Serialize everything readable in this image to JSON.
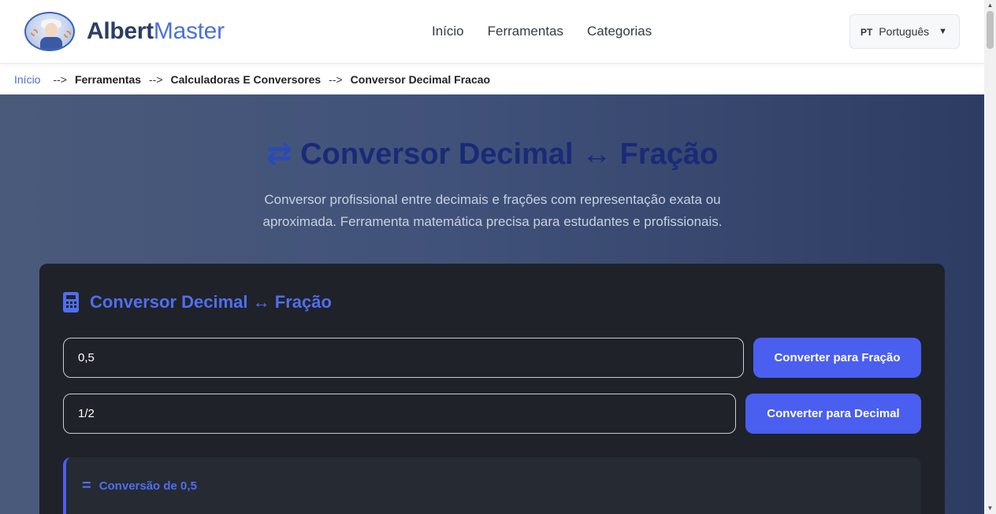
{
  "brand": {
    "part1": "Albert",
    "part2": "Master"
  },
  "nav": [
    {
      "label": "Início"
    },
    {
      "label": "Ferramentas"
    },
    {
      "label": "Categorias"
    }
  ],
  "language": {
    "code": "PT",
    "name": "Português",
    "caret": "▼"
  },
  "breadcrumb": {
    "separator": "-->",
    "items": [
      "Início",
      "Ferramentas",
      "Calculadoras E Conversores",
      "Conversor Decimal Fracao"
    ]
  },
  "hero": {
    "icon": "⇄",
    "title": "Conversor Decimal ↔ Fração",
    "subtitle": "Conversor profissional entre decimais e frações com representação exata ou aproximada. Ferramenta matemática precisa para estudantes e profissionais."
  },
  "card": {
    "title": "Conversor Decimal ↔ Fração",
    "decimal_input": {
      "value": "0,5"
    },
    "decimal_button": "Converter para Fração",
    "fraction_input": {
      "value": "1/2"
    },
    "fraction_button": "Converter para Decimal",
    "result": {
      "icon": "=",
      "title": "Conversão de 0,5"
    }
  },
  "colors": {
    "accent": "#4a5ef0",
    "hero_title": "#1a2a78",
    "card_bg": "#1f2228",
    "brand_dark": "#2a3e66",
    "brand_light": "#4b72d8"
  }
}
